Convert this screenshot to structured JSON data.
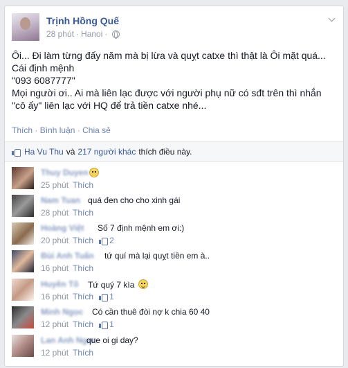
{
  "post": {
    "author": "Trịnh Hồng Quế",
    "time": "28 phút",
    "separator": "·",
    "location": "Hanoi",
    "globe_icon": "globe-icon",
    "lines": [
      "Ôi... Đi làm từng đấy năm mà bị lừa và quỵt catxe thì thật là Ôi mặt quá...",
      "Cái định mệnh",
      "\"093 6087777\"",
      "Mọi người ơi.. Ai mà liên lạc được với người phụ nữ có sđt trên thì nhắn",
      "\"cô ấy\" liên lạc với HQ để trả tiền catxe nhé..."
    ],
    "actions": {
      "like": "Thích",
      "comment": "Bình luận",
      "share": "Chia sẻ",
      "dot": "·"
    }
  },
  "likes_bar": {
    "first_liker": "Ha Vu Thu",
    "conjunction": "và",
    "others": "217 người khác",
    "suffix": "thích điều này."
  },
  "comments": [
    {
      "name": "Thuy Duyen",
      "text": "",
      "emoji": "frown",
      "time": "25 phút",
      "like_label": "Thích",
      "likes": ""
    },
    {
      "name": "Nam Tuan",
      "text": "quá đen cho cho xinh gái",
      "emoji": "",
      "time": "28 phút",
      "like_label": "Thích",
      "likes": ""
    },
    {
      "name": "Hoàng Việt",
      "text": "Số 7 định mệnh em ơi:)",
      "emoji": "",
      "time": "20 phút",
      "like_label": "Thích",
      "likes": "2"
    },
    {
      "name": "Bùi Anh Tuấn",
      "text": "tứ quí mà lại quỵt tiền em à..",
      "emoji": "",
      "time": "16 phút",
      "like_label": "Thích",
      "likes": ""
    },
    {
      "name": "Huyền Tô",
      "text": "Tứ quý 7 kìa",
      "emoji": "laugh",
      "time": "16 phút",
      "like_label": "Thích",
      "likes": "1"
    },
    {
      "name": "Minh Ngọc",
      "text": "Có cần thuê đòi nợ k chia 60 40",
      "emoji": "",
      "time": "12 phút",
      "like_label": "Thích",
      "likes": "1"
    },
    {
      "name": "Lan Anh Ngọc",
      "text": "que oi gi day?",
      "emoji": "",
      "time": "12 phút",
      "like_label": "Thích",
      "likes": ""
    }
  ],
  "colors": {
    "link": "#3b5998",
    "muted": "#9197a3",
    "action": "#6d84b4",
    "background": "#e9ebee"
  }
}
